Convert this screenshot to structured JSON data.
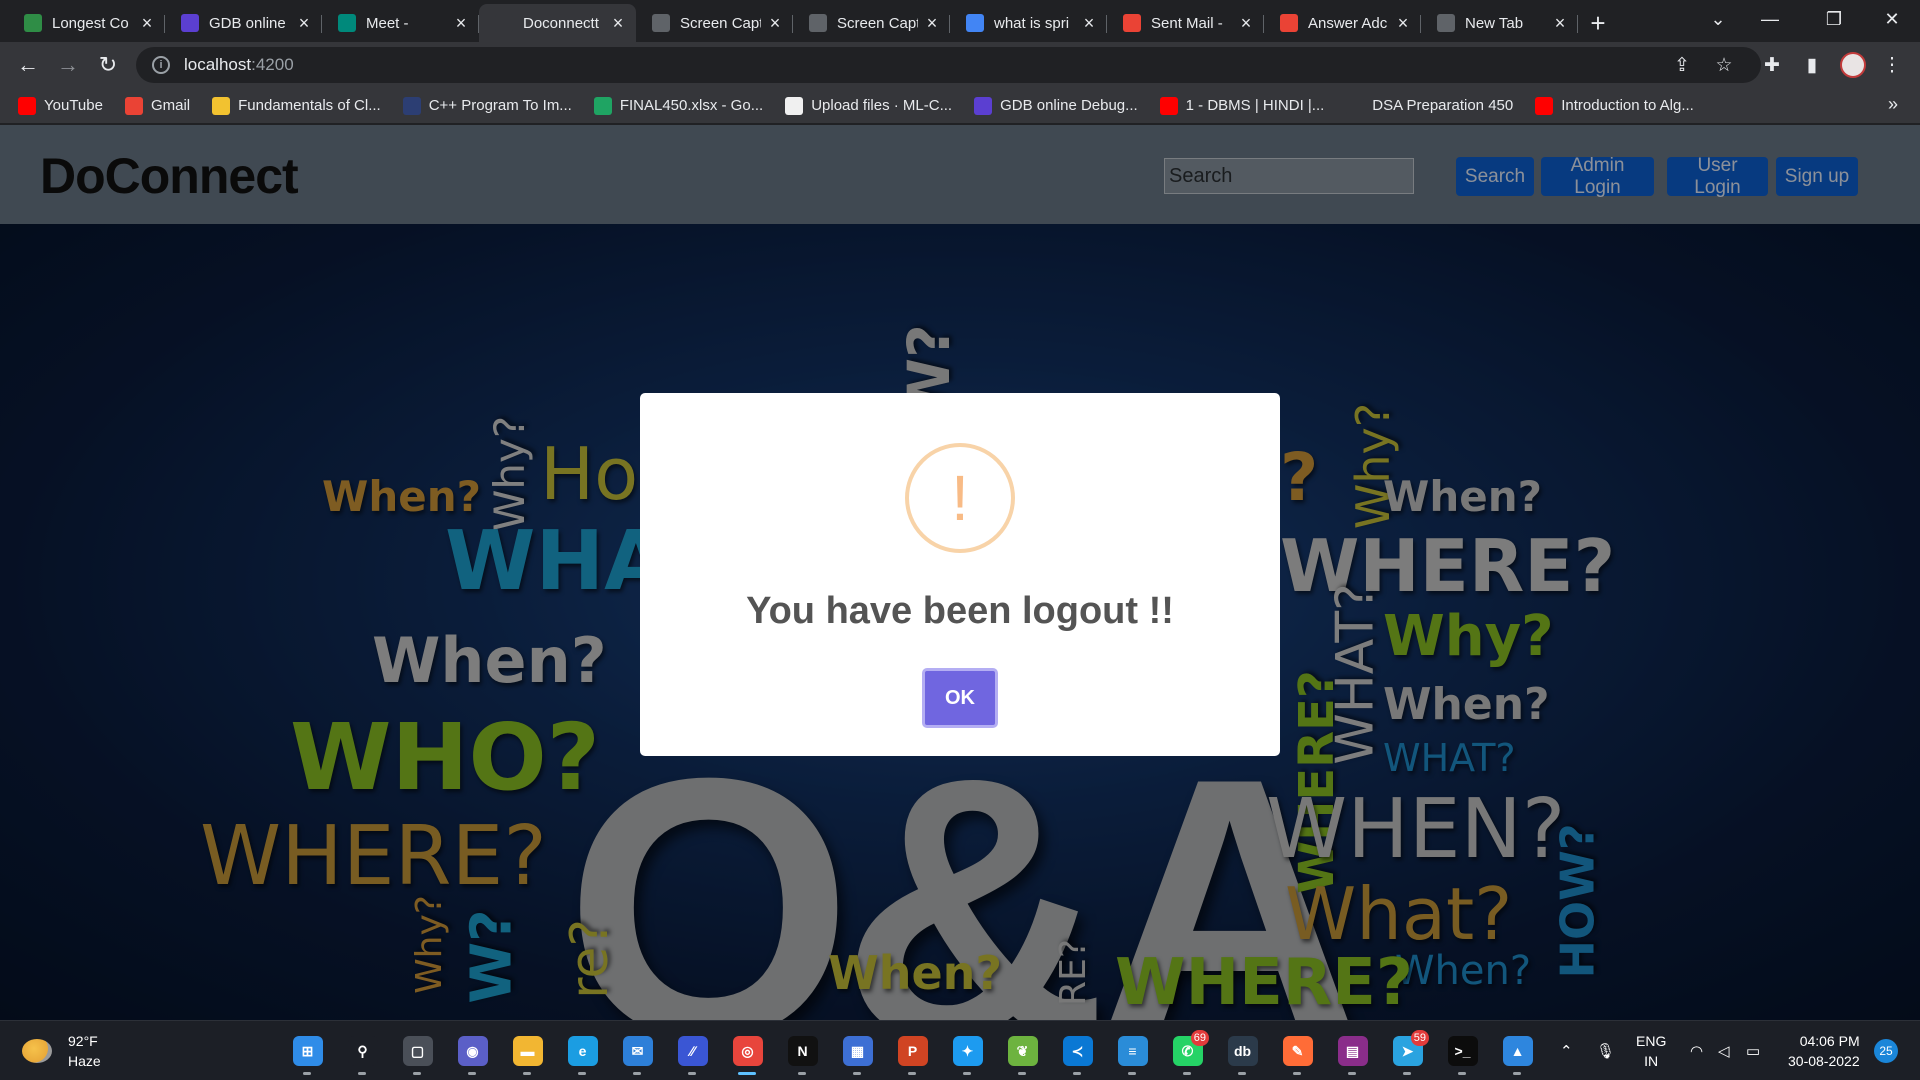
{
  "browser": {
    "tabs": [
      {
        "title": "Longest Co",
        "favicon": "gfg-icon",
        "color": "#2f8d46"
      },
      {
        "title": "GDB online",
        "favicon": "gdb-icon",
        "color": "#5b3fd1"
      },
      {
        "title": "Meet -",
        "favicon": "meet-icon",
        "color": "#00897b"
      },
      {
        "title": "Doconnectt",
        "favicon": "angular-icon",
        "color": "#35363a",
        "active": true
      },
      {
        "title": "Screen Capt",
        "favicon": "camera-icon",
        "color": "#5f6368"
      },
      {
        "title": "Screen Capt",
        "favicon": "camera-icon",
        "color": "#5f6368"
      },
      {
        "title": "what is spri",
        "favicon": "google-icon",
        "color": "#4285f4"
      },
      {
        "title": "Sent Mail -",
        "favicon": "gmail-icon",
        "color": "#ea4335"
      },
      {
        "title": "Answer Adc",
        "favicon": "gmail-icon",
        "color": "#ea4335"
      },
      {
        "title": "New Tab",
        "favicon": "chrome-icon",
        "color": "#5f6368"
      }
    ],
    "new_tab_glyph": "+",
    "url_host": "localhost",
    "url_port": ":4200",
    "bookmarks": [
      {
        "label": "YouTube",
        "icon": "youtube-icon",
        "color": "#ff0000"
      },
      {
        "label": "Gmail",
        "icon": "gmail-icon",
        "color": "#ea4335"
      },
      {
        "label": "Fundamentals of Cl...",
        "icon": "coin-icon",
        "color": "#f2c230"
      },
      {
        "label": "C++ Program To Im...",
        "icon": "cpp-icon",
        "color": "#2c3e73"
      },
      {
        "label": "FINAL450.xlsx - Go...",
        "icon": "drive-icon",
        "color": "#1fa463"
      },
      {
        "label": "Upload files · ML-C...",
        "icon": "github-icon",
        "color": "#f0f0f0"
      },
      {
        "label": "GDB online Debug...",
        "icon": "gdb-icon",
        "color": "#5b3fd1"
      },
      {
        "label": "1 - DBMS | HINDI |...",
        "icon": "youtube-icon",
        "color": "#ff0000"
      },
      {
        "label": "DSA Preparation 450",
        "icon": "angular-icon",
        "color": "#35363a"
      },
      {
        "label": "Introduction to Alg...",
        "icon": "youtube-icon",
        "color": "#ff0000"
      }
    ],
    "bookmarks_more": "»"
  },
  "page": {
    "brand": "DoConnect",
    "search_placeholder": "Search",
    "search_button": "Search",
    "admin_login": "Admin Login",
    "user_login": "User Login",
    "signup": "Sign up",
    "hero_words": {
      "center": "Q&A",
      "left": [
        "When?",
        "Why?",
        "How",
        "WHAT",
        "When?",
        "WHO?",
        "WHERE?",
        "Why?",
        "W?",
        "re?",
        "When?"
      ],
      "right": [
        "?",
        "Why?",
        "When?",
        "WHERE?",
        "WHERE?",
        "WHAT?",
        "Why?",
        "When?",
        "WHAT?",
        "WHEN?",
        "What?",
        "HOW?",
        "When?",
        "WHERE?",
        "RE?"
      ],
      "top": "W?"
    }
  },
  "dialog": {
    "icon_glyph": "!",
    "title": "You have been logout !!",
    "ok_label": "OK",
    "accent": "#7066e0"
  },
  "taskbar": {
    "temperature": "92°F",
    "condition": "Haze",
    "apps": [
      {
        "name": "start-icon",
        "color": "#2f8ce8",
        "glyph": "⊞"
      },
      {
        "name": "search-icon",
        "color": "#1c1f26",
        "glyph": "⚲"
      },
      {
        "name": "task-view-icon",
        "color": "#4a4f58",
        "glyph": "▢"
      },
      {
        "name": "teams-chat-icon",
        "color": "#5b5fc7",
        "glyph": "◉"
      },
      {
        "name": "file-explorer-icon",
        "color": "#f2b632",
        "glyph": "▬"
      },
      {
        "name": "edge-icon",
        "color": "#1b9de2",
        "glyph": "e"
      },
      {
        "name": "mail-icon",
        "color": "#2d7fd8",
        "glyph": "✉"
      },
      {
        "name": "visual-studio-icon",
        "color": "#3a56d4",
        "glyph": "∕∕"
      },
      {
        "name": "chrome-icon",
        "color": "#e8453c",
        "glyph": "◎",
        "active": true
      },
      {
        "name": "netflix-icon",
        "color": "#111111",
        "glyph": "N"
      },
      {
        "name": "store-icon",
        "color": "#3d6fd4",
        "glyph": "▦"
      },
      {
        "name": "powerpoint-icon",
        "color": "#d04423",
        "glyph": "P"
      },
      {
        "name": "twitter-icon",
        "color": "#1d9bf0",
        "glyph": "✦"
      },
      {
        "name": "spring-icon",
        "color": "#6db33f",
        "glyph": "❦"
      },
      {
        "name": "vscode-icon",
        "color": "#0a78d4",
        "glyph": "≺"
      },
      {
        "name": "notepad-icon",
        "color": "#2a8cd8",
        "glyph": "≡"
      },
      {
        "name": "whatsapp-icon",
        "color": "#25d366",
        "glyph": "✆",
        "badge": "69"
      },
      {
        "name": "mysql-icon",
        "color": "#2b3a4a",
        "glyph": "db"
      },
      {
        "name": "postman-icon",
        "color": "#ff6c37",
        "glyph": "✎"
      },
      {
        "name": "winrar-icon",
        "color": "#8a2d8a",
        "glyph": "▤"
      },
      {
        "name": "telegram-icon",
        "color": "#2aa3e0",
        "glyph": "➤",
        "badge": "59"
      },
      {
        "name": "terminal-icon",
        "color": "#0c0c0c",
        "glyph": ">_"
      },
      {
        "name": "photos-icon",
        "color": "#2e86de",
        "glyph": "▲"
      }
    ],
    "lang_top": "ENG",
    "lang_bottom": "IN",
    "time": "04:06 PM",
    "date": "30-08-2022",
    "notifications": "25"
  }
}
